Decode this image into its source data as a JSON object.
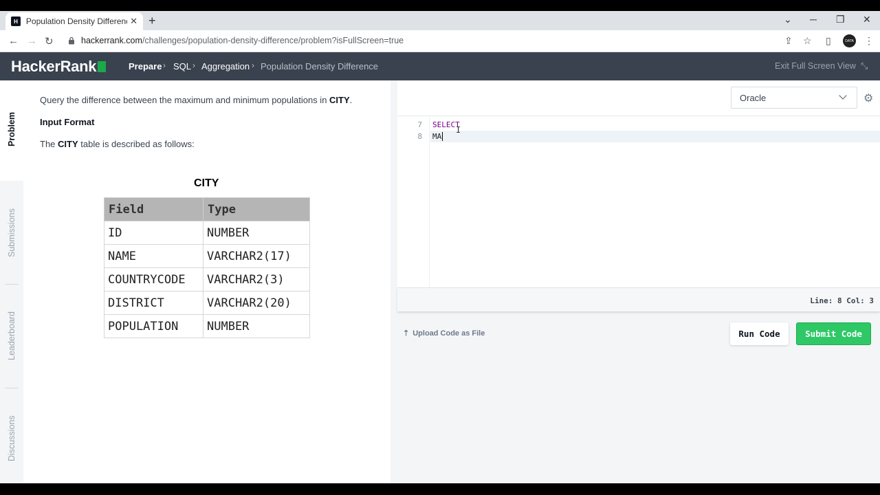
{
  "browser": {
    "tab_title": "Population Density Difference | H",
    "favicon_text": "H",
    "new_tab": "+",
    "url_host": "hackerrank.com",
    "url_path": "/challenges/population-density-difference/problem?isFullScreen=true",
    "profile_text": "DATA"
  },
  "header": {
    "logo": "HackerRank",
    "breadcrumbs": [
      "Prepare",
      "SQL",
      "Aggregation",
      "Population Density Difference"
    ],
    "exit_fullscreen": "Exit Full Screen View"
  },
  "sidebar": {
    "tabs": [
      "Problem",
      "Submissions",
      "Leaderboard",
      "Discussions"
    ]
  },
  "problem": {
    "intro_prefix": "Query the difference between the maximum and minimum populations in ",
    "intro_bold": "CITY",
    "intro_suffix": ".",
    "input_format_heading": "Input Format",
    "desc_prefix": "The ",
    "desc_bold": "CITY",
    "desc_suffix": " table is described as follows:",
    "table_caption": "CITY",
    "table_headers": [
      "Field",
      "Type"
    ],
    "table_rows": [
      [
        "ID",
        "NUMBER"
      ],
      [
        "NAME",
        "VARCHAR2(17)"
      ],
      [
        "COUNTRYCODE",
        "VARCHAR2(3)"
      ],
      [
        "DISTRICT",
        "VARCHAR2(20)"
      ],
      [
        "POPULATION",
        "NUMBER"
      ]
    ]
  },
  "editor": {
    "language": "Oracle",
    "lines": [
      {
        "num": "7",
        "text": "SELECT"
      },
      {
        "num": "8",
        "text": "MA"
      }
    ],
    "status": "Line: 8 Col: 3",
    "upload_label": "Upload Code as File",
    "run_label": "Run Code",
    "submit_label": "Submit Code"
  },
  "colors": {
    "header_bg": "#39424e",
    "accent_green": "#2ec866",
    "keyword": "#770088"
  }
}
